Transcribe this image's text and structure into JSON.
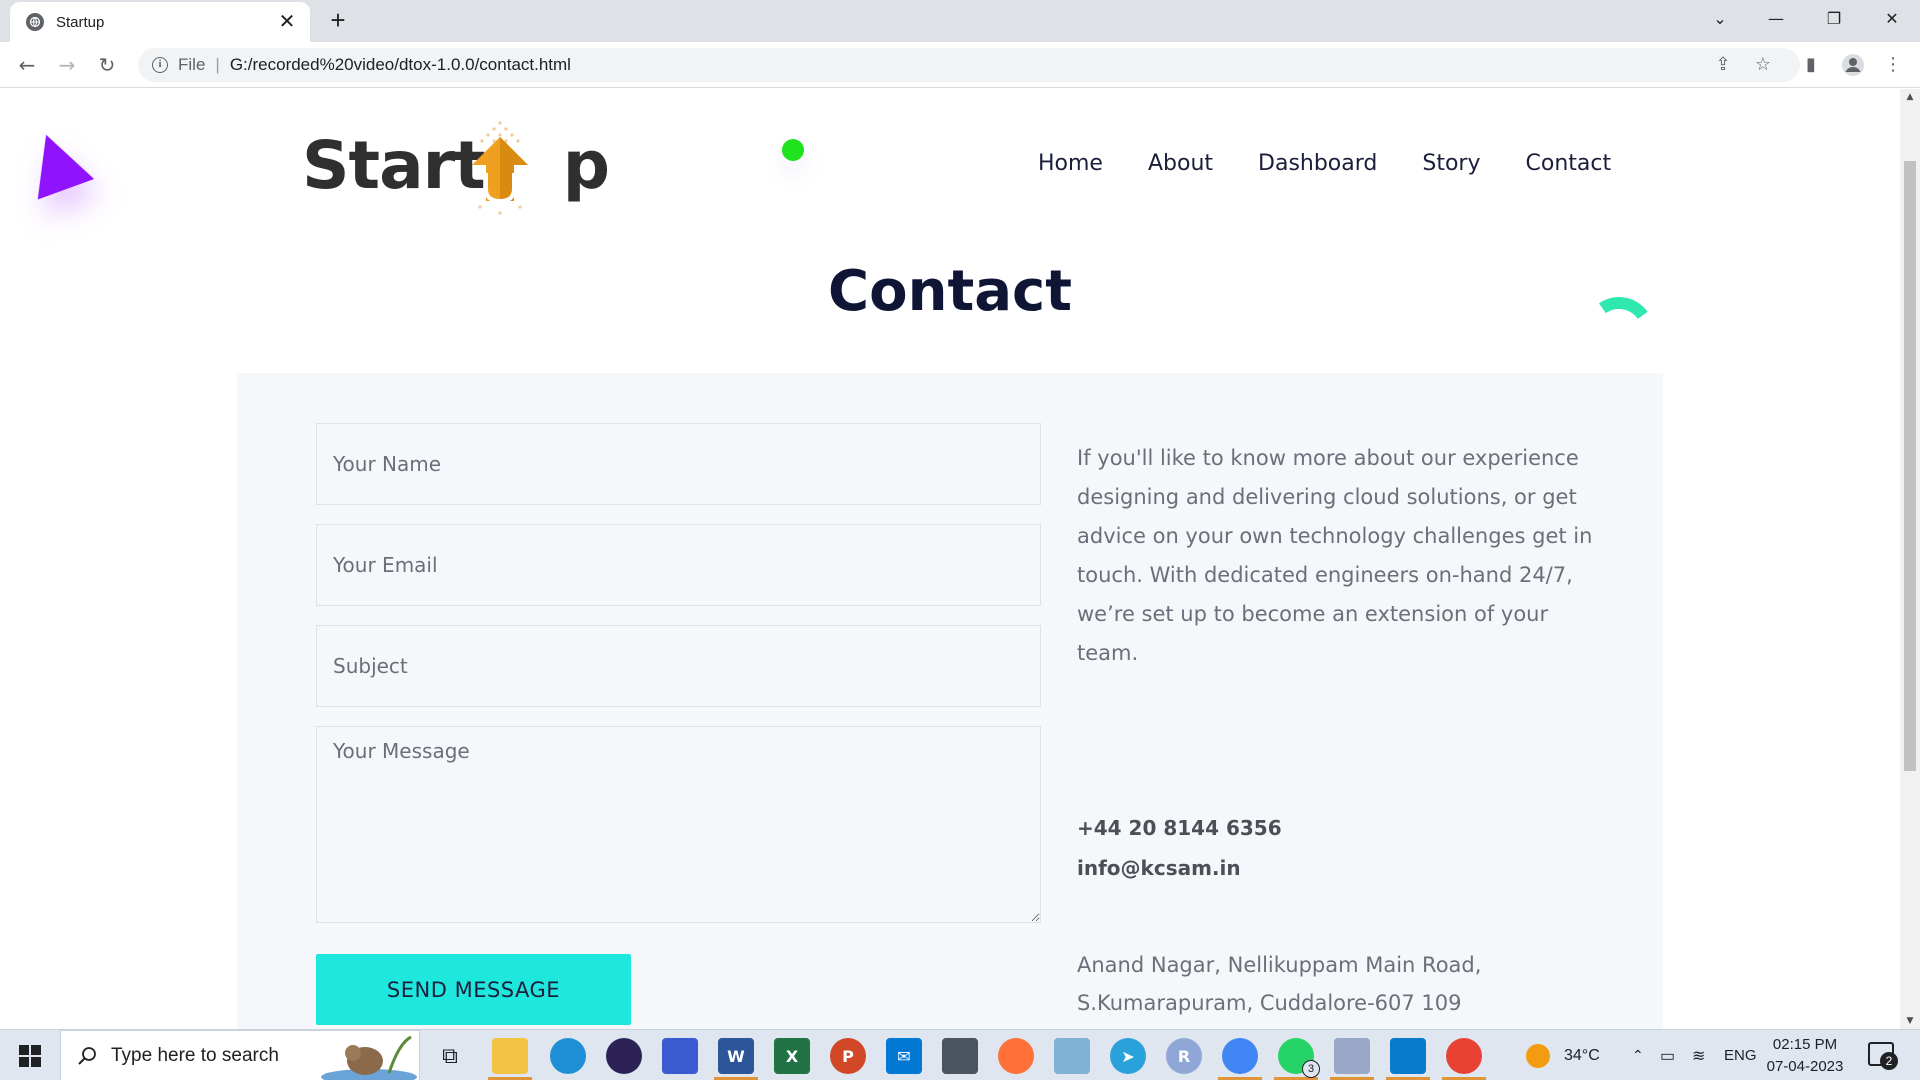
{
  "browser": {
    "tab_title": "Startup",
    "tab_close": "✕",
    "new_tab": "+",
    "omnibox": {
      "scheme": "File",
      "url": "G:/recorded%20video/dtox-1.0.0/contact.html"
    },
    "icons": [
      "back-icon",
      "forward-icon",
      "reload-icon",
      "info-icon",
      "share-icon",
      "star-icon",
      "sidepanel-icon",
      "profile-icon",
      "menu-icon"
    ]
  },
  "site": {
    "logo_text": "Start",
    "logo_tail": "p",
    "nav": [
      "Home",
      "About",
      "Dashboard",
      "Story",
      "Contact"
    ],
    "page_title": "Contact",
    "form": {
      "name_placeholder": "Your Name",
      "email_placeholder": "Your Email",
      "subject_placeholder": "Subject",
      "message_placeholder": "Your Message",
      "submit_label": "SEND MESSAGE"
    },
    "info": {
      "text": "If you'll like to know more about our experience designing and delivering cloud solutions, or get advice on your own technology challenges get in touch. With dedicated engineers on-hand 24/7, we’re set up to become an extension of your team.",
      "phone": "+44 20 8144 6356",
      "email": "info@kcsam.in",
      "address": "Anand Nagar, Nellikuppam Main Road, S.Kumarapuram, Cuddalore-607 109"
    },
    "colors": {
      "accent": "#1ee8dd",
      "triangle": "#9013fe",
      "dot": "#1ee31e",
      "arc": "#2ee8b0",
      "heading": "#0f1535"
    }
  },
  "taskbar": {
    "search_placeholder": "Type here to search",
    "weather_temp": "34°C",
    "language": "ENG",
    "time": "02:15 PM",
    "date": "07-04-2023",
    "whatsapp_badge": "3",
    "notification_count": "2",
    "apps": [
      "file-explorer",
      "edge",
      "eclipse",
      "notepad",
      "word",
      "excel",
      "powerpoint",
      "mail",
      "calculator",
      "firefox",
      "photos",
      "telegram",
      "r-studio",
      "chrome-profile",
      "whatsapp",
      "snipping-tool",
      "vscode",
      "chrome"
    ]
  }
}
